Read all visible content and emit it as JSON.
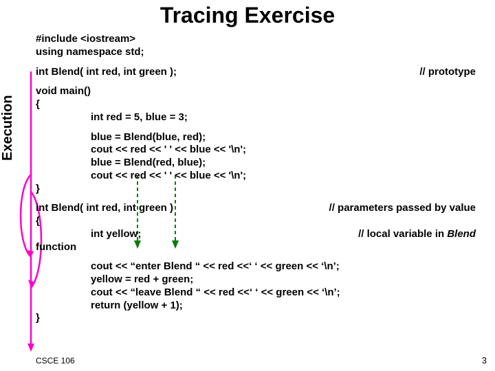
{
  "title": "Tracing Exercise",
  "exec_label": "Execution",
  "code": {
    "l01": "#include <iostream>",
    "l02": "using namespace std;",
    "l03": "int Blend( int red, int green );",
    "l03_comment": "// prototype",
    "l04": "void main()",
    "l05": "{",
    "l06": "int red = 5, blue = 3;",
    "l07": "blue = Blend(blue, red);",
    "l08": "cout << red << ' ' << blue << '\\n';",
    "l09": "blue = Blend(red, blue);",
    "l10": "cout << red << ' ' << blue << '\\n';",
    "l11": "}",
    "l12": "int Blend( int red, int green )",
    "l12_comment": "// parameters passed by value",
    "l13": "{",
    "l14": "int yellow;",
    "l14_comment_a": "// local variable in ",
    "l14_comment_b": "Blend",
    "l15": "function",
    "l16": "cout << “enter Blend “ << red <<‘ ‘ << green << ‘\\n’;",
    "l17": "yellow = red + green;",
    "l18": "cout << “leave Blend “ << red <<‘ ‘ << green << ‘\\n’;",
    "l19": "return (yellow + 1);",
    "l20": "}"
  },
  "footer": {
    "course": "CSCE 106",
    "page": "3"
  }
}
